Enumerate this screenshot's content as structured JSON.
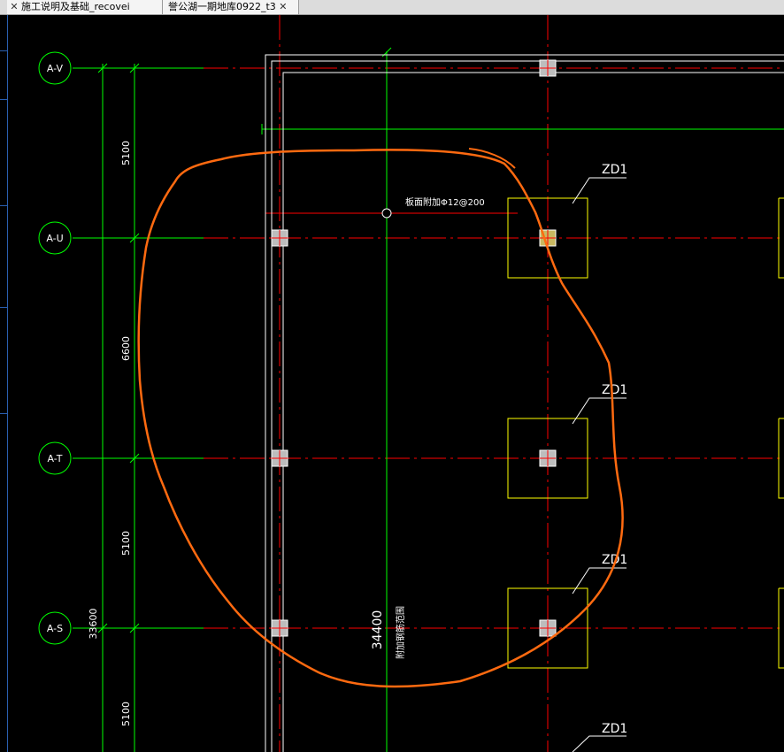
{
  "tabs": [
    {
      "label": "施工说明及基础_recovei",
      "close": "✕"
    },
    {
      "label": "誉公湖一期地库0922_t3",
      "close": "✕"
    }
  ],
  "axes": [
    "A-V",
    "A-U",
    "A-T",
    "A-S"
  ],
  "dimensions": {
    "d1": "5100",
    "d2": "6600",
    "d3": "5100",
    "d4": "5100",
    "total_outer": "33600",
    "total_inner": "34400"
  },
  "labels": {
    "rebar_note": "板面附加Φ12@200",
    "vertical_note": "附加钢筋范围"
  },
  "footing_tag": "ZD1",
  "colors": {
    "background": "#000000",
    "axis_green": "#00ff00",
    "column_red": "#ff0000",
    "footing_yellow": "#ffff00",
    "wall_white": "#ffffff",
    "markup_orange": "#ff6a10"
  }
}
